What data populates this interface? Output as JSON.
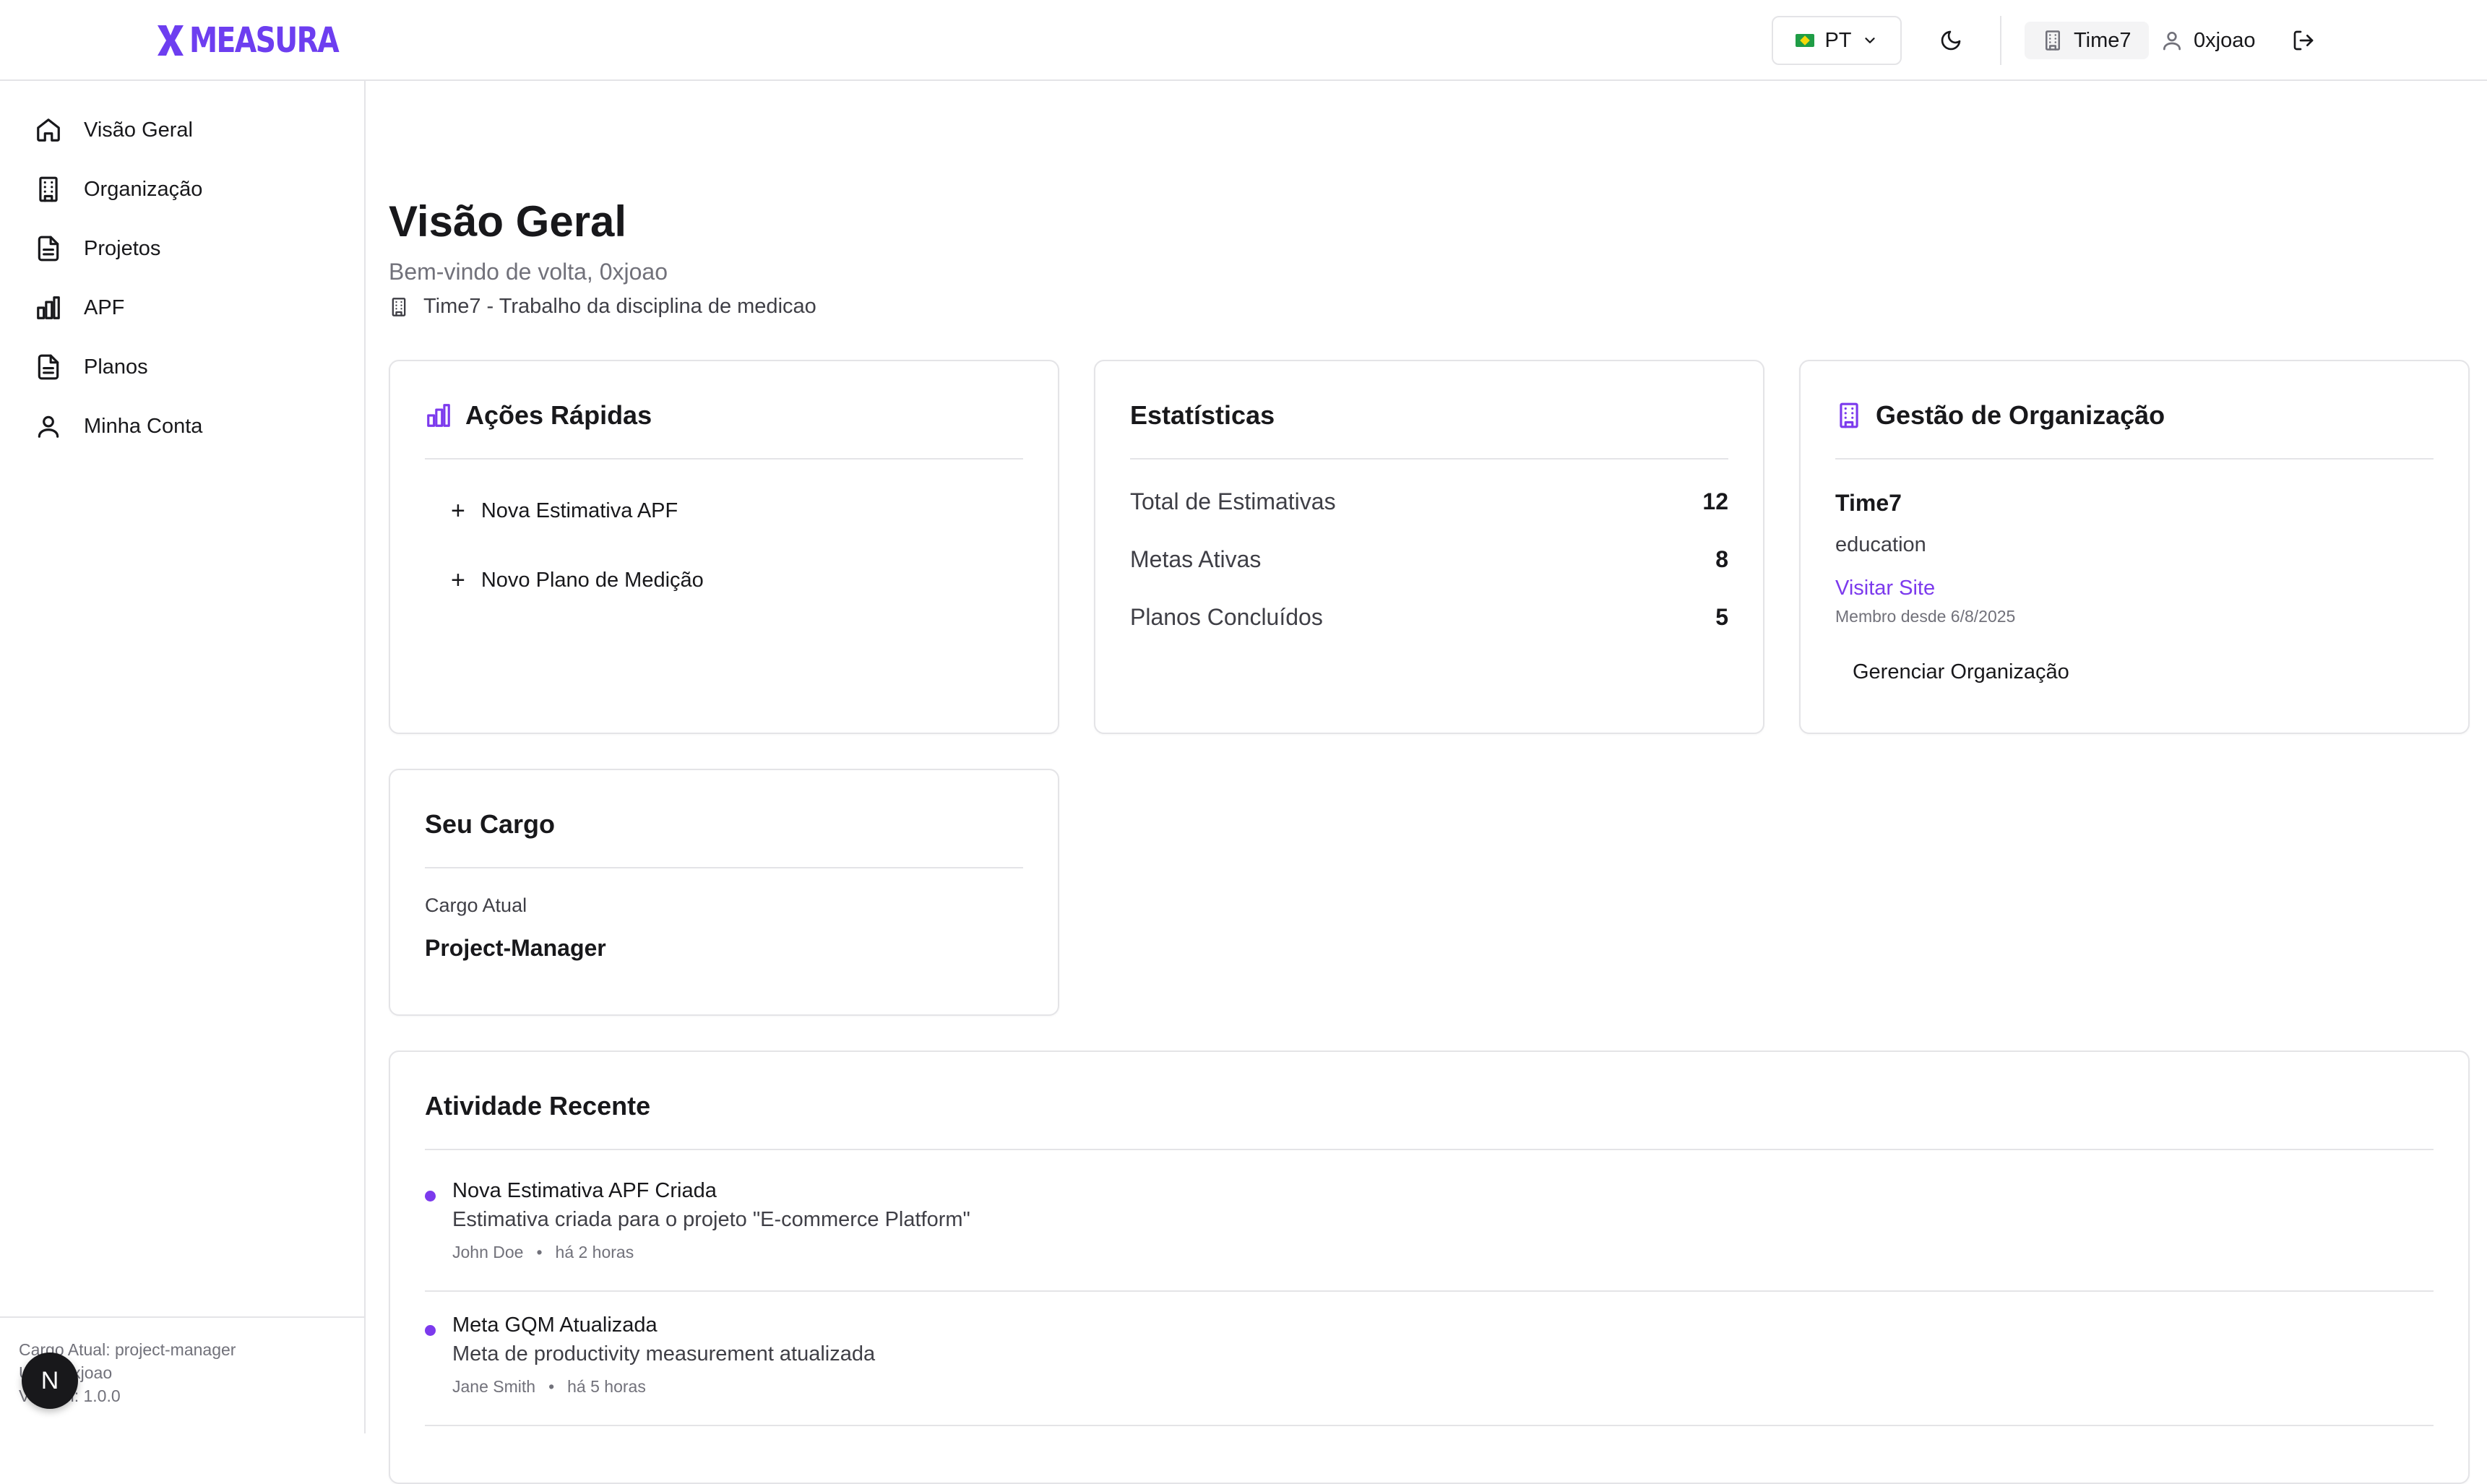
{
  "header": {
    "brand": "MEASURA",
    "language": "PT",
    "org": "Time7",
    "user": "0xjoao"
  },
  "sidebar": {
    "items": [
      {
        "label": "Visão Geral",
        "icon": "home-icon"
      },
      {
        "label": "Organização",
        "icon": "building-icon"
      },
      {
        "label": "Projetos",
        "icon": "file-icon"
      },
      {
        "label": "APF",
        "icon": "bar-chart-icon"
      },
      {
        "label": "Planos",
        "icon": "file-icon"
      },
      {
        "label": "Minha Conta",
        "icon": "user-icon"
      }
    ],
    "footer": {
      "role": "Cargo Atual: project-manager",
      "user": "User: 0xjoao",
      "version": "Version: 1.0.0"
    },
    "badge": "N"
  },
  "main": {
    "title": "Visão Geral",
    "welcome": "Bem-vindo de volta, 0xjoao",
    "org_line": "Time7 - Trabalho da disciplina de medicao"
  },
  "quick_actions": {
    "title": "Ações Rápidas",
    "items": [
      "Nova Estimativa APF",
      "Novo Plano de Medição"
    ]
  },
  "stats": {
    "title": "Estatísticas",
    "rows": [
      {
        "label": "Total de Estimativas",
        "value": "12"
      },
      {
        "label": "Metas Ativas",
        "value": "8"
      },
      {
        "label": "Planos Concluídos",
        "value": "5"
      }
    ]
  },
  "org_mgmt": {
    "title": "Gestão de Organização",
    "name": "Time7",
    "type": "education",
    "link": "Visitar Site",
    "member_since": "Membro desde 6/8/2025",
    "manage": "Gerenciar Organização"
  },
  "role": {
    "title": "Seu Cargo",
    "label": "Cargo Atual",
    "value": "Project-Manager"
  },
  "activity": {
    "title": "Atividade Recente",
    "items": [
      {
        "title": "Nova Estimativa APF Criada",
        "desc": "Estimativa criada para o projeto \"E-commerce Platform\"",
        "user": "John Doe",
        "time": "há 2 horas"
      },
      {
        "title": "Meta GQM Atualizada",
        "desc": "Meta de productivity measurement atualizada",
        "user": "Jane Smith",
        "time": "há 5 horas"
      }
    ]
  },
  "colors": {
    "accent": "#7c3aed",
    "brand": "#6d3ef0",
    "border": "#e4e4e7"
  }
}
